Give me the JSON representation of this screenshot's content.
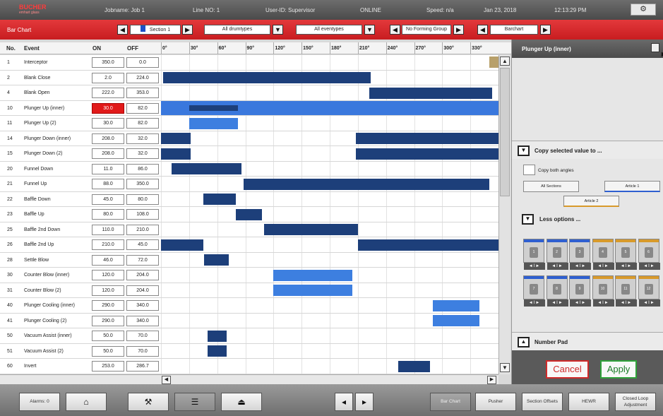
{
  "status": {
    "logo": "BUCHER",
    "logo_sub": "emhart glass",
    "jobname": "Jobname: Job 1",
    "line": "Line NO: 1",
    "user": "User-ID: Supervisor",
    "state": "ONLINE",
    "speed": "Speed: n/a",
    "date": "Jan 23, 2018",
    "time": "12:13:29 PM",
    "settings_icon": "gear-icon"
  },
  "toolbar": {
    "title": "Bar Chart",
    "section": "Section 1",
    "drum_types": "All drumtypes",
    "event_types": "All eventypes",
    "forming_group": "No Forming Group",
    "view": "Barchart",
    "accent": "#1e50c8"
  },
  "table": {
    "headers": {
      "no": "No.",
      "event": "Event",
      "on": "ON",
      "off": "OFF"
    },
    "degrees": [
      "0°",
      "30°",
      "60°",
      "90°",
      "120°",
      "150°",
      "180°",
      "210°",
      "240°",
      "270°",
      "300°",
      "330°"
    ],
    "rows": [
      {
        "no": "1",
        "event": "Interceptor",
        "on": "350.0",
        "off": "0.0",
        "bars": []
      },
      {
        "no": "2",
        "event": "Blank Close",
        "on": "2.0",
        "off": "224.0",
        "bars": [
          {
            "on": 2,
            "off": 224
          }
        ]
      },
      {
        "no": "4",
        "event": "Blank Open",
        "on": "222.0",
        "off": "353.0",
        "bars": [
          {
            "on": 222,
            "off": 353
          }
        ]
      },
      {
        "no": "10",
        "event": "Plunger Up (inner)",
        "on": "30.0",
        "off": "82.0",
        "selected": true,
        "bars": [
          {
            "on": 30,
            "off": 82
          }
        ]
      },
      {
        "no": "11",
        "event": "Plunger Up (2)",
        "on": "30.0",
        "off": "82.0",
        "bars": [
          {
            "on": 30,
            "off": 82,
            "light": true
          }
        ]
      },
      {
        "no": "14",
        "event": "Plunger Down (inner)",
        "on": "208.0",
        "off": "32.0",
        "bars": [
          {
            "on": 0,
            "off": 32
          },
          {
            "on": 208,
            "off": 360
          }
        ]
      },
      {
        "no": "15",
        "event": "Plunger Down (2)",
        "on": "208.0",
        "off": "32.0",
        "bars": [
          {
            "on": 0,
            "off": 32
          },
          {
            "on": 208,
            "off": 360
          }
        ]
      },
      {
        "no": "20",
        "event": "Funnel Down",
        "on": "11.0",
        "off": "86.0",
        "bars": [
          {
            "on": 11,
            "off": 86
          }
        ]
      },
      {
        "no": "21",
        "event": "Funnel Up",
        "on": "88.0",
        "off": "350.0",
        "bars": [
          {
            "on": 88,
            "off": 350
          }
        ]
      },
      {
        "no": "22",
        "event": "Baffle Down",
        "on": "45.0",
        "off": "80.0",
        "bars": [
          {
            "on": 45,
            "off": 80
          }
        ]
      },
      {
        "no": "23",
        "event": "Baffle Up",
        "on": "80.0",
        "off": "108.0",
        "bars": [
          {
            "on": 80,
            "off": 108
          }
        ]
      },
      {
        "no": "25",
        "event": "Baffle 2nd Down",
        "on": "110.0",
        "off": "210.0",
        "bars": [
          {
            "on": 110,
            "off": 210
          }
        ]
      },
      {
        "no": "26",
        "event": "Baffle 2nd Up",
        "on": "210.0",
        "off": "45.0",
        "bars": [
          {
            "on": 0,
            "off": 45
          },
          {
            "on": 210,
            "off": 360
          }
        ]
      },
      {
        "no": "28",
        "event": "Settle Blow",
        "on": "46.0",
        "off": "72.0",
        "bars": [
          {
            "on": 46,
            "off": 72
          }
        ]
      },
      {
        "no": "30",
        "event": "Counter Blow (inner)",
        "on": "120.0",
        "off": "204.0",
        "bars": [
          {
            "on": 120,
            "off": 204,
            "light": true
          }
        ]
      },
      {
        "no": "31",
        "event": "Counter Blow (2)",
        "on": "120.0",
        "off": "204.0",
        "bars": [
          {
            "on": 120,
            "off": 204,
            "light": true
          }
        ]
      },
      {
        "no": "40",
        "event": "Plunger Cooling (inner)",
        "on": "290.0",
        "off": "340.0",
        "bars": [
          {
            "on": 290,
            "off": 340,
            "light": true
          }
        ]
      },
      {
        "no": "41",
        "event": "Plunger Cooling (2)",
        "on": "290.0",
        "off": "340.0",
        "bars": [
          {
            "on": 290,
            "off": 340,
            "light": true
          }
        ]
      },
      {
        "no": "50",
        "event": "Vacuum Assist (inner)",
        "on": "50.0",
        "off": "70.0",
        "bars": [
          {
            "on": 50,
            "off": 70
          }
        ]
      },
      {
        "no": "51",
        "event": "Vacuum Assist (2)",
        "on": "50.0",
        "off": "70.0",
        "bars": [
          {
            "on": 50,
            "off": 70
          }
        ]
      },
      {
        "no": "60",
        "event": "Invert",
        "on": "253.0",
        "off": "286.7",
        "bars": [
          {
            "on": 253,
            "off": 286.7
          }
        ]
      }
    ]
  },
  "panel": {
    "title": "Plunger Up (inner)",
    "copy_header": "Copy selected value to ...",
    "copy_both": "Copy both angles",
    "all_sections": "All Sections",
    "article1": "Article 1",
    "article2": "Article 2",
    "less_options": "Less options ...",
    "tiles_top": [
      "1",
      "2",
      "3",
      "4",
      "5",
      "6"
    ],
    "tiles_bottom": [
      "7",
      "8",
      "9",
      "10",
      "11",
      "12"
    ],
    "tile_control": "◄I►",
    "number_pad": "Number Pad",
    "cancel": "Cancel",
    "apply": "Apply"
  },
  "bottom": {
    "alarms": "Alarms: 0",
    "bar_chart": "Bar Chart",
    "pusher": "Pusher",
    "section_offsets": "Section Offsets",
    "hewr": "HEWR",
    "closed_loop_1": "Closed Loop",
    "closed_loop_2": "Adjustment"
  }
}
